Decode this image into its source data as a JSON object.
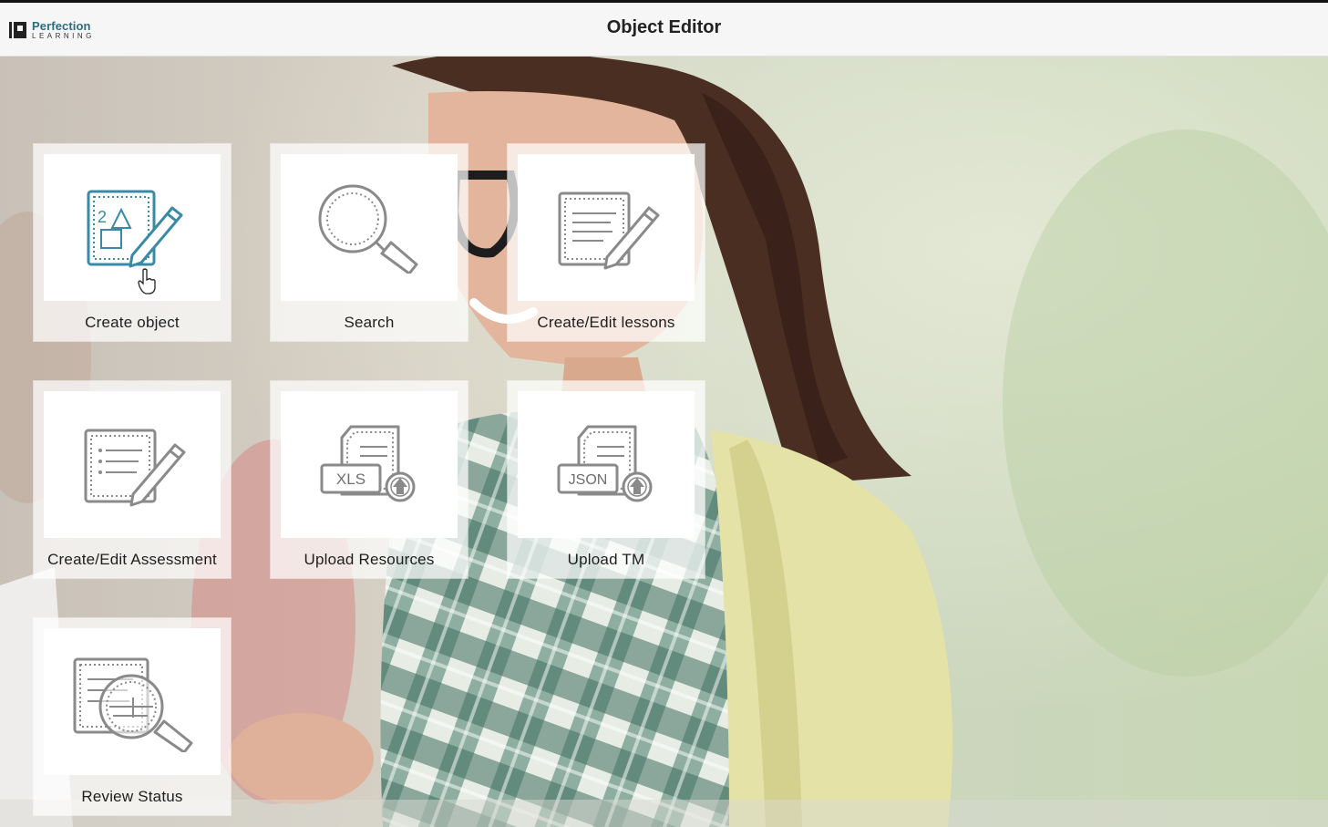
{
  "header": {
    "brand": "Perfection",
    "brand_sub": "LEARNING",
    "title": "Object Editor"
  },
  "tiles": [
    {
      "label": "Create object",
      "icon": "create-object-icon"
    },
    {
      "label": "Search",
      "icon": "search-icon"
    },
    {
      "label": "Create/Edit lessons",
      "icon": "edit-lessons-icon"
    },
    {
      "label": "Create/Edit Assessment",
      "icon": "edit-assessment-icon"
    },
    {
      "label": "Upload Resources",
      "icon": "upload-xls-icon",
      "badge": "XLS"
    },
    {
      "label": "Upload TM",
      "icon": "upload-json-icon",
      "badge": "JSON"
    },
    {
      "label": "Review Status",
      "icon": "review-status-icon"
    }
  ],
  "colors": {
    "accent": "#3a8aa5",
    "icon_gray": "#8a8a8a",
    "header_bg": "#f6f6f6"
  }
}
